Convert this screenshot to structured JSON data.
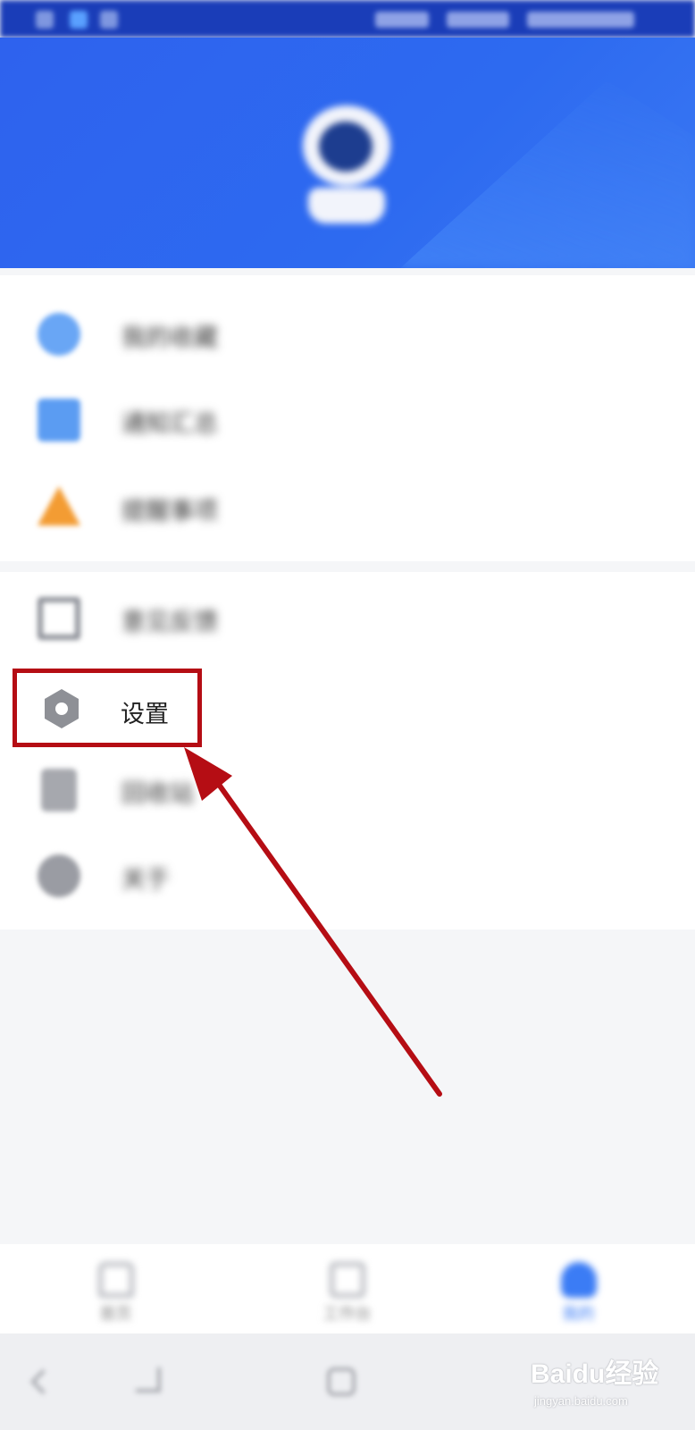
{
  "status_bar": {
    "left_indicators": [
      "status-icon",
      "message-icon",
      "notification-icon"
    ],
    "right_indicators": [
      "signal-icon",
      "wifi-icon",
      "battery-icon",
      "clock"
    ]
  },
  "header": {
    "avatar_icon": "astronaut-avatar-icon",
    "accent_color": "#2e62ee"
  },
  "menu_group_1": [
    {
      "label": "我的收藏",
      "icon": "shield-icon"
    },
    {
      "label": "通知汇总",
      "icon": "square-icon"
    },
    {
      "label": "提醒事项",
      "icon": "warning-triangle-icon"
    }
  ],
  "menu_group_2": [
    {
      "label": "意见反馈",
      "icon": "flag-icon"
    },
    {
      "label": "设置",
      "icon": "settings-hexagon-icon"
    },
    {
      "label": "回收站",
      "icon": "trash-icon"
    },
    {
      "label": "关于",
      "icon": "info-circle-icon"
    }
  ],
  "highlight": {
    "target": "设置",
    "color": "#b50d14"
  },
  "tab_bar": [
    {
      "label": "首页",
      "icon": "home-icon",
      "active": false
    },
    {
      "label": "工作台",
      "icon": "grid-icon",
      "active": false
    },
    {
      "label": "我的",
      "icon": "person-icon",
      "active": true
    }
  ],
  "watermark": {
    "logo": "Baidu经验",
    "url": "jingyan.baidu.com"
  }
}
